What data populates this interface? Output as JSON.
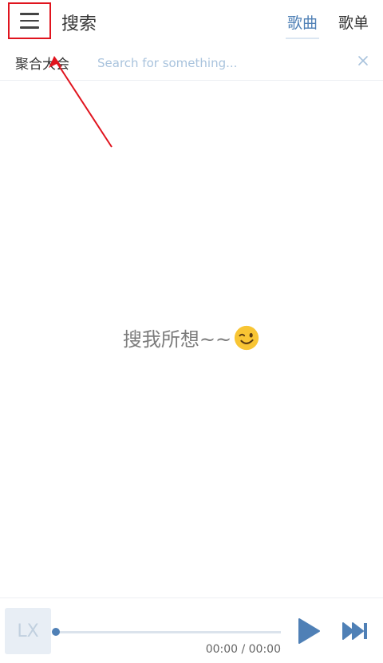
{
  "header": {
    "title": "搜索",
    "tabs": [
      {
        "label": "歌曲",
        "active": true
      },
      {
        "label": "歌单",
        "active": false
      }
    ]
  },
  "search": {
    "source_label": "聚合大会",
    "placeholder": "Search for something...",
    "value": ""
  },
  "empty_state": {
    "message": "搜我所想~~",
    "emoji": "winking-face"
  },
  "player": {
    "cover_text": "LX",
    "current_time": "00:00",
    "total_time": "00:00",
    "time_display": "00:00 / 00:00",
    "progress": 0
  },
  "colors": {
    "accent": "#4f80b6",
    "highlight_box": "#e0141e",
    "placeholder": "#a9c3dd",
    "text": "#333333"
  },
  "icons": {
    "menu": "hamburger-menu-icon",
    "clear": "close-icon",
    "play": "play-icon",
    "next": "skip-next-icon"
  }
}
